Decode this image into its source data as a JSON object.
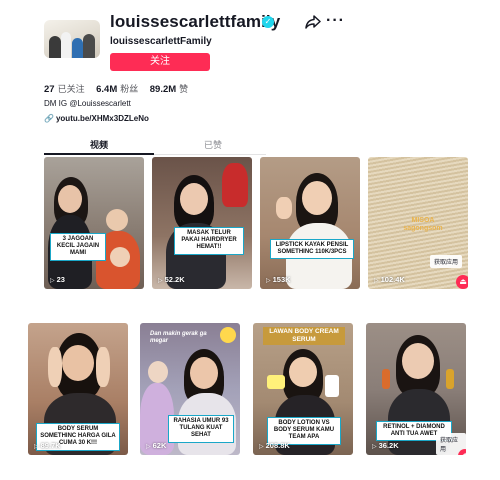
{
  "profile": {
    "username": "louissescarlettfamily",
    "nickname": "louissescarlettFamily",
    "follow_label": "关注",
    "bio": "DM IG @Louissescarlett",
    "link": "youtu.be/XHMx3DZLeNo"
  },
  "stats": {
    "following_count": "27",
    "following_label": "已关注",
    "followers_count": "6.4M",
    "followers_label": "粉丝",
    "likes_count": "89.2M",
    "likes_label": "赞"
  },
  "tabs": {
    "videos": "视频",
    "liked": "已赞"
  },
  "get_app_label": "获取应用",
  "videos": [
    {
      "caption": "3 JAGOAN KECIL JAGAIN MAMI",
      "views": "23"
    },
    {
      "caption": "MASAK TELUR PAKAI HAIRDRYER HEMAT!!",
      "views": "52.2K"
    },
    {
      "caption": "LIPSTICK KAYAK PENSIL SOMETHINC 110K/3PCS",
      "views": "153K"
    },
    {
      "caption": "",
      "views": "102.4K",
      "overlay_text": "MISOA sagongsom"
    },
    {
      "caption": "BODY SERUM SOMETHINC HARGA GILA CUMA 30 K!!!",
      "views": "89.7K"
    },
    {
      "caption": "RAHASIA UMUR 93 TULANG KUAT SEHAT",
      "views": "62K",
      "overlay_text": "Dan makin gerak ga megar"
    },
    {
      "caption": "BODY LOTION VS BODY SERUM KAMU TEAM APA",
      "views": "208.8K",
      "overlay_text": "LAWAN BODY CREAM SERUM"
    },
    {
      "caption": "RETINOL + DIAMOND ANTI TUA AWET",
      "views": "36.2K"
    }
  ],
  "colors": {
    "accent": "#fe2c55",
    "verified": "#20d5ec",
    "caption_border": "#1aa7c8"
  }
}
